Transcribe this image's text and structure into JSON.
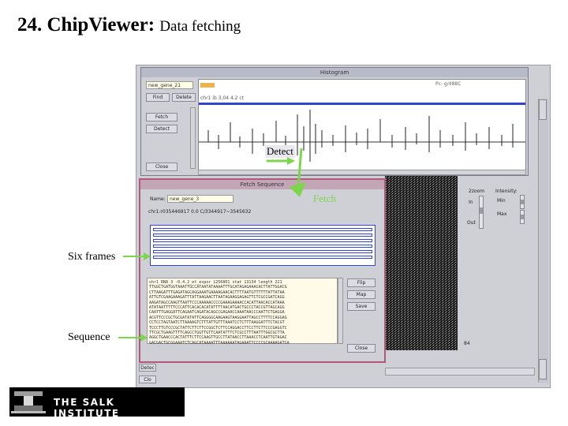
{
  "slide": {
    "title": "24. ChipViewer:",
    "subtitle": "Data fetching"
  },
  "annotations": {
    "detect": "Detect",
    "fetch": "Fetch",
    "six_frames": "Six frames",
    "sequence": "Sequence"
  },
  "histogram_window": {
    "title": "Histogram",
    "gene_field": "new_gene_21",
    "find_label": "Find",
    "delete_label": "Delete",
    "fetch_label": "Fetch",
    "detect_label": "Detect",
    "close_label": "Close",
    "position_text": "chr1 ib 3,04 4.2 ct",
    "right_text": "Pc: g/488C"
  },
  "fetch_window": {
    "title": "Fetch Sequence",
    "name_label": "Name:",
    "name_value": "new_gene_3",
    "coords": "chr1:r035446917 0.0 C/3344917~3545632",
    "flip_label": "Flip",
    "map_label": "Map",
    "save_label": "Save",
    "close_label": "Close",
    "sequence_lines": [
      "chr1_RNA_3 -0.4.2_et_expor 1256801 stat 13134 length 221",
      "TTGGCTGATGGTAAATTGCCATAATATAAAATTTGCATAGAGAAACACTTATTGGACG",
      "CTTAAGATTTGAGATAGCAGGAAATGAAAAGAACACTTTTAATGTTTTTTATTATAA",
      "ATTGTCGAAGAAAGATTTATTAAGAACTTAATAGAAGGAGAGTTCTCGCCGATCAGG",
      "AAGATAGCCAAGTTAATTCCCAAAAACCCCGAAAGAAAACCACATTAACACCATAAA",
      "ATATAATTTTTCCCATTCACACACATATTTTAACATGACTGCCCTACCGTTAGCAGG",
      "CAATTTGAGGATTCAGAATCAGATACAGCCGAGAACCAAATAACCCAATTCTGAGGA",
      "ACGTTCCCGCTGCGATATATTCAGGGGCAAGAAGTAAGGAATTAGCCTTTTCCAGGAG",
      "CCTCCTAGTAATCTTAAAAGTCTTTATTGTTTAAATCCTCTTTAAGGATTTCTACGT",
      "TCCCTTGTCCCGCTATTCTTCTTCCGGCTCTTCCAGGACCTTCCTTCTTCCCGAGGTC",
      "TTCGCTGAAGTTTTCAGCCTGGTTGTTCAATATTTCTCGCCTTTAATTTGGCGCTTA",
      "AGGCTGAACCCACTATTTCTTCCAAGTTGCCTTATAACCTTAAACCTCAATTGTAGAC",
      "GACGACTGCGGAAATCTCAGCATAAAATTTAAAAAATAGAAATTCCCCGCAAAAGATCA"
    ]
  },
  "side_panel": {
    "zoom_label": "2zoom",
    "intensity_label": "Intensity:",
    "in_label": "In",
    "out_label": "Out",
    "min_label": "Min",
    "max_label": "Max",
    "bottom_text": "84"
  },
  "bottom_strip": {
    "label1": "Detec",
    "label2": "Clo"
  },
  "logo": {
    "text": "THE SALK INSTITUTE"
  }
}
